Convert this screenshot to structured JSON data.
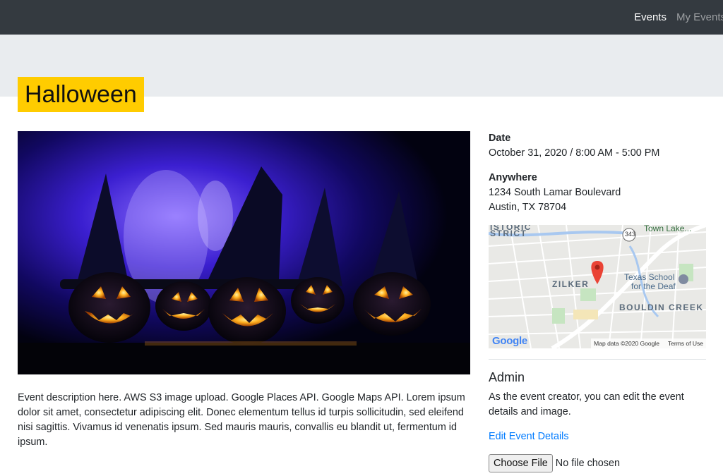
{
  "nav": {
    "links": [
      {
        "label": "Events"
      },
      {
        "label": "My Events"
      }
    ]
  },
  "event": {
    "title": "Halloween",
    "description": "Event description here. AWS S3 image upload. Google Places API. Google Maps API. Lorem ipsum dolor sit amet, consectetur adipiscing elit. Donec elementum tellus id turpis sollicitudin, sed eleifend nisi sagittis. Vivamus id venenatis ipsum. Sed mauris mauris, convallis eu blandit ut, fermentum id ipsum.",
    "date_label": "Date",
    "date_value": "October 31, 2020 / 8:00 AM - 5:00 PM",
    "location_name": "Anywhere",
    "address_line1": "1234 South Lamar Boulevard",
    "address_line2": "Austin, TX 78704"
  },
  "map": {
    "labels": {
      "historic": "ISTORIC",
      "district": "STRICT",
      "zilker": "ZILKER",
      "bouldin": "BOULDIN CREEK",
      "town_lake": "Town Lake...",
      "school": "Texas School",
      "school2": "for the Deaf",
      "road_343": "343"
    },
    "footer_data": "Map data ©2020 Google",
    "footer_terms": "Terms of Use",
    "logo": "Google"
  },
  "admin": {
    "title": "Admin",
    "text": "As the event creator, you can edit the event details and image.",
    "edit_link": "Edit Event Details",
    "file_button": "Choose File",
    "file_status": "No file chosen"
  },
  "colors": {
    "navbar": "#343a40",
    "jumbotron": "#e9ecef",
    "title_highlight": "#ffcc00",
    "link": "#007bff",
    "map_pin": "#ea4335"
  }
}
